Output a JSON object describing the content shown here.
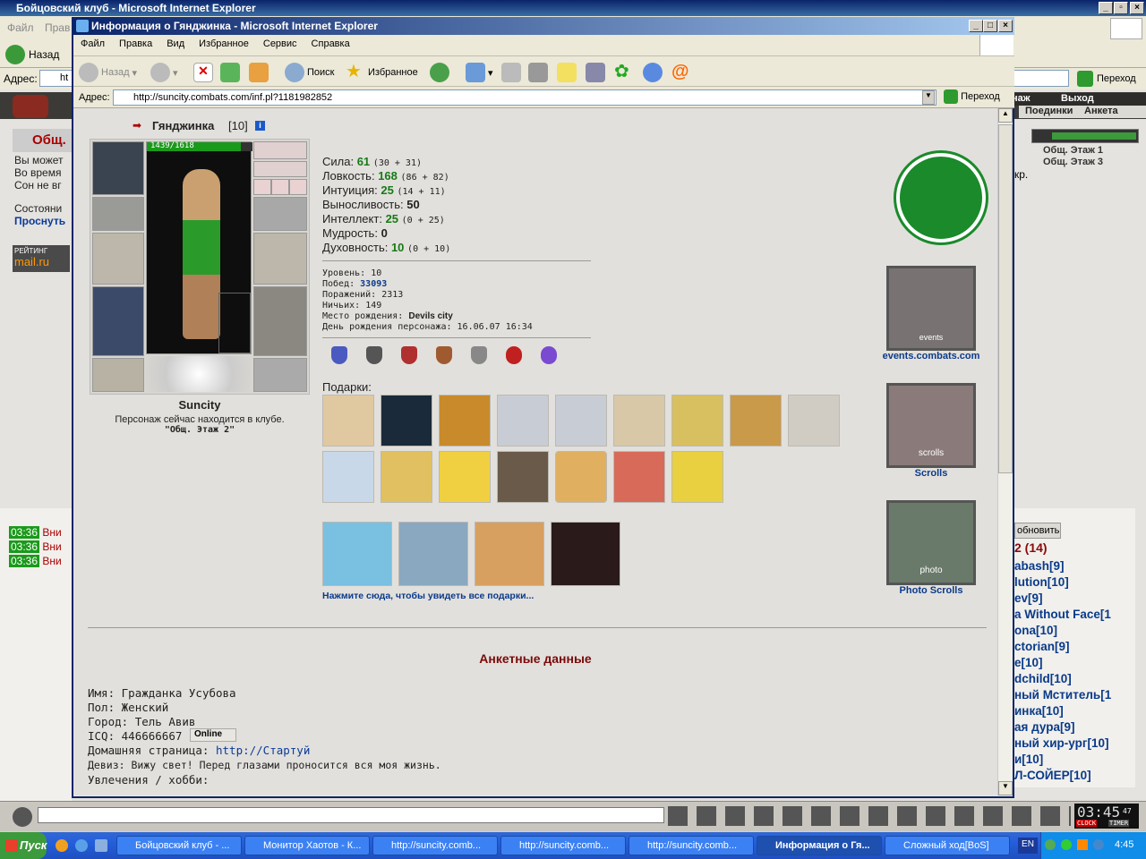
{
  "bg_window": {
    "title": "Бойцовский клуб - Microsoft Internet Explorer",
    "menu": [
      "Файл",
      "Прав"
    ],
    "back_label": "Назад",
    "addr_label": "Адрес:",
    "addr_value": "ht",
    "go_label": "Переход",
    "nav_right": [
      "наж",
      "Выход",
      "Поединки",
      "Анкета"
    ],
    "left_chat": {
      "title": "Общ.",
      "lines": [
        "Вы может",
        "Во время",
        "Сон не вг"
      ],
      "state": "Состояни",
      "wake": "Проснуть",
      "rating": "РЕЙТИНГ",
      "mailru": "mail.ru"
    },
    "right_locations": [
      "Общ. Этаж 1",
      "Общ. Этаж 3"
    ],
    "right_frag": "кр.",
    "refresh": "обновить",
    "online_count": "2 (14)",
    "online_list": [
      "abash[9]",
      "lution[10]",
      "ev[9]",
      "a Without Face[1",
      "ona[10]",
      "ctorian[9]",
      "e[10]",
      "dchild[10]",
      "ный Мститель[1",
      "инка[10]",
      "ая дура[9]",
      "ный хир-ург[10]",
      "и[10]",
      "Л-СОЙЕР[10]"
    ],
    "chat_lines": [
      {
        "time": "03:36",
        "text": "Вни"
      },
      {
        "time": "03:36",
        "text": "Вни"
      },
      {
        "time": "03:36",
        "text": "Вни"
      }
    ],
    "clock": "03:45",
    "clock_sec": "47",
    "clock_label": "CLOCK",
    "timer_label": "TIMER"
  },
  "popup": {
    "title": "Информация о Гянджинка - Microsoft Internet Explorer",
    "menu": [
      "Файл",
      "Правка",
      "Вид",
      "Избранное",
      "Сервис",
      "Справка"
    ],
    "toolbar": {
      "back": "Назад",
      "search": "Поиск",
      "favorites": "Избранное"
    },
    "addr_label": "Адрес:",
    "url": "http://suncity.combats.com/inf.pl?1181982852",
    "go": "Переход"
  },
  "character": {
    "name": "Гянджинка",
    "level": "[10]",
    "hp": "1439/1618",
    "hp_fraction": 0.89,
    "city": "Suncity",
    "location_text": "Персонаж сейчас находится в клубе.",
    "location": "\"Общ. Этаж 2\""
  },
  "stats": [
    {
      "label": "Сила:",
      "value": "61",
      "detail": "(30 + 31)"
    },
    {
      "label": "Ловкость:",
      "value": "168",
      "detail": "(86 + 82)"
    },
    {
      "label": "Интуиция:",
      "value": "25",
      "detail": "(14 + 11)"
    },
    {
      "label": "Выносливость:",
      "value": "50",
      "detail": ""
    },
    {
      "label": "Интеллект:",
      "value": "25",
      "detail": "(0 + 25)"
    },
    {
      "label": "Мудрость:",
      "value": "0",
      "detail": ""
    },
    {
      "label": "Духовность:",
      "value": "10",
      "detail": "(0 + 10)"
    }
  ],
  "info": [
    {
      "label": "Уровень:",
      "value": "10"
    },
    {
      "label": "Побед:",
      "value": "33093"
    },
    {
      "label": "Поражений:",
      "value": "2313"
    },
    {
      "label": "Ничьих:",
      "value": "149"
    },
    {
      "label": "Место рождения:",
      "value": "Devils city"
    },
    {
      "label": "День рождения персонажа:",
      "value": "16.06.07 16:34"
    }
  ],
  "gifts_label": "Подарки:",
  "gifts_link": "Нажмите сюда, чтобы увидеть все подарки...",
  "side_links": {
    "events": "events.combats.com",
    "scrolls": "Scrolls",
    "photo": "Photo Scrolls",
    "banner_events": "events",
    "banner_scrolls": "scrolls",
    "banner_photo": "photo"
  },
  "profile": {
    "heading": "Анкетные данные",
    "name_label": "Имя:",
    "name": "Гражданка Усубова",
    "sex_label": "Пол:",
    "sex": "Женский",
    "city_label": "Город:",
    "city": "Тель Авив",
    "icq_label": "ICQ:",
    "icq": "446666667",
    "icq_status": "Online",
    "home_label": "Домашняя страница:",
    "home": "http://Стартуй",
    "motto_label": "Девиз:",
    "motto": "Вижу свет! Перед глазами проносится вся моя жизнь.",
    "hobby_label": "Увлечения / хобби:",
    "cursor": "_"
  },
  "taskbar": {
    "start": "Пуск",
    "tasks": [
      "Бойцовский клуб - ...",
      "Монитор Хаотов - К...",
      "http://suncity.comb...",
      "http://suncity.comb...",
      "http://suncity.comb...",
      "Информация о Гя...",
      "Сложный ход[BoS]"
    ],
    "lang": "EN",
    "time": "4:45"
  },
  "colors": {
    "hp_green": "#1a9a1a",
    "stat_green": "#177a17",
    "link_blue": "#0a3a8a",
    "heading_red": "#7a0a0a"
  }
}
